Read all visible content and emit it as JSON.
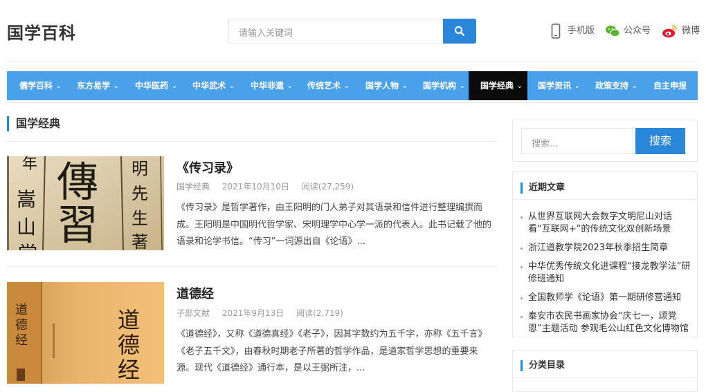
{
  "header": {
    "logo": "国学百科",
    "search_placeholder": "请输入关键词",
    "links": [
      {
        "label": "手机版",
        "icon": "mobile-icon"
      },
      {
        "label": "公众号",
        "icon": "wechat-icon"
      },
      {
        "label": "微博",
        "icon": "weibo-icon"
      }
    ]
  },
  "nav": {
    "items": [
      {
        "label": "儒学百科",
        "has_menu": true
      },
      {
        "label": "东方易学",
        "has_menu": true
      },
      {
        "label": "中华医药",
        "has_menu": true
      },
      {
        "label": "中华武术",
        "has_menu": true
      },
      {
        "label": "中华非遗",
        "has_menu": true
      },
      {
        "label": "传统艺术",
        "has_menu": true
      },
      {
        "label": "国学人物",
        "has_menu": true
      },
      {
        "label": "国学机构",
        "has_menu": true
      },
      {
        "label": "国学经典",
        "has_menu": true,
        "active": true
      },
      {
        "label": "国学资讯",
        "has_menu": true
      },
      {
        "label": "政策支持",
        "has_menu": true
      },
      {
        "label": "自主申报",
        "has_menu": false
      }
    ]
  },
  "main": {
    "section_title": "国学经典",
    "posts": [
      {
        "title": "《传习录》",
        "category": "国学经典",
        "date": "2021年10月10日",
        "views": "阅读(27,259)",
        "excerpt": "《传习录》是哲学著作，由王阳明的门人弟子对其语录和信件进行整理编撰而成。王阳明是中国明代哲学家、宋明理学中心学一派的代表人。此书记载了他的语录和论学书信。“传习”一词源出自《论语》..."
      },
      {
        "title": "道德经",
        "category": "子部文献",
        "date": "2021年9月13日",
        "views": "阅读(2,719)",
        "excerpt": "《道德经》，又称《道德真经》《老子》，因其字数约为五千字，亦称《五千言》《老子五千文》，由春秋时期老子所著的哲学作品，是道家哲学思想的重要来源。现代《道德经》通行本，是以王弼所注，..."
      }
    ]
  },
  "sidebar": {
    "search_placeholder": "搜索...",
    "search_button": "搜索",
    "recent_title": "近期文章",
    "recent_posts": [
      "从世界互联网大会数字文明尼山对话看“互联网+”的传统文化双创新场景",
      "浙江道教学院2023年秋季招生简章",
      "中华优秀传统文化进课程“接龙教学法”研修班通知",
      "全国教师学《论语》第一期研修营通知",
      "泰安市农民书画家协会“庆七一，颂党恩”主题活动 参观毛公山红色文化博物馆"
    ],
    "categories_title": "分类目录"
  },
  "colors": {
    "accent": "#2a86d9",
    "nav_bg": "#4ba0ea",
    "nav_active": "#0b0b0b"
  }
}
